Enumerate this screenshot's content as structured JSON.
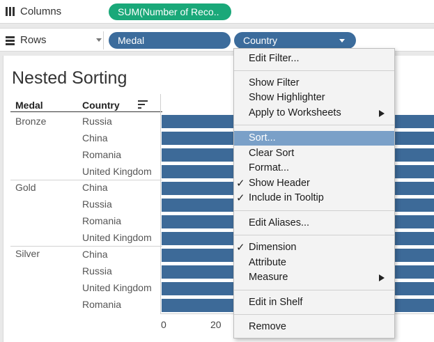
{
  "shelves": {
    "columns_label": "Columns",
    "columns_pill": "SUM(Number of Reco..",
    "rows_label": "Rows",
    "rows_pills": [
      "Medal",
      "Country"
    ]
  },
  "sheet": {
    "title": "Nested Sorting",
    "headers": {
      "medal": "Medal",
      "country": "Country"
    },
    "groups": [
      {
        "medal": "Bronze",
        "countries": [
          "Russia",
          "China",
          "Romania",
          "United Kingdom"
        ]
      },
      {
        "medal": "Gold",
        "countries": [
          "China",
          "Russia",
          "Romania",
          "United Kingdom"
        ]
      },
      {
        "medal": "Silver",
        "countries": [
          "China",
          "Russia",
          "United Kingdom",
          "Romania"
        ]
      }
    ],
    "axis_ticks": [
      "0",
      "20"
    ]
  },
  "menu": {
    "items": [
      "Edit Filter...",
      "Show Filter",
      "Show Highlighter",
      "Apply to Worksheets",
      "Sort...",
      "Clear Sort",
      "Format...",
      "Show Header",
      "Include in Tooltip",
      "Edit Aliases...",
      "Dimension",
      "Attribute",
      "Measure",
      "Edit in Shelf",
      "Remove"
    ],
    "checked_mark": "✓"
  },
  "colors": {
    "measure_pill": "#1aa879",
    "dimension_pill": "#3c6c9c",
    "bar": "#3d6a98",
    "menu_highlight": "#7aa0c8"
  }
}
